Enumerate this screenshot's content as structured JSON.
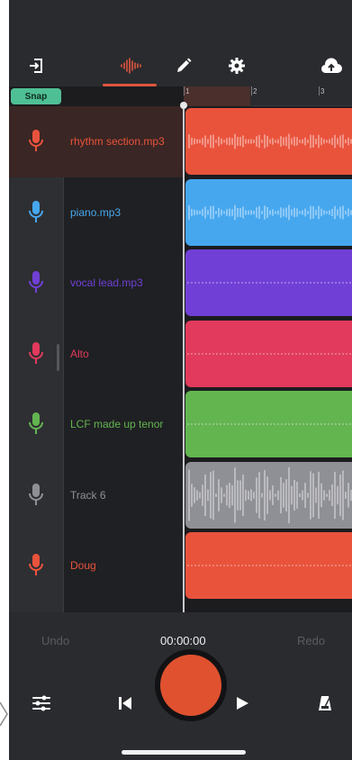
{
  "toolbar": {
    "snap_label": "Snap",
    "ruler_numbers": [
      "1",
      "2",
      "3"
    ]
  },
  "colors": {
    "accent": "#e0553e",
    "snap": "#4fbf95",
    "record": "#e0512f"
  },
  "tracks": [
    {
      "name": "rhythm section.mp3",
      "color": "#e9533c",
      "selected": true
    },
    {
      "name": "piano.mp3",
      "color": "#46a7ef",
      "selected": false
    },
    {
      "name": "vocal lead.mp3",
      "color": "#7040d6",
      "selected": false
    },
    {
      "name": "Alto",
      "color": "#e13a5c",
      "selected": false
    },
    {
      "name": "LCF made up tenor",
      "color": "#63b550",
      "selected": false
    },
    {
      "name": "Track 6",
      "color": "#8f9096",
      "selected": false
    },
    {
      "name": "Doug",
      "color": "#e9533c",
      "selected": false
    }
  ],
  "transport": {
    "undo_label": "Undo",
    "redo_label": "Redo",
    "timecode": "00:00:00"
  },
  "icons": {
    "exit": "exit-icon",
    "waveform": "waveform-icon",
    "edit": "pencil-icon",
    "settings": "gear-icon",
    "upload": "cloud-upload-icon",
    "mixer": "sliders-icon",
    "skip_back": "skip-back-icon",
    "record": "record-icon",
    "play": "play-icon",
    "metronome": "metronome-icon"
  }
}
